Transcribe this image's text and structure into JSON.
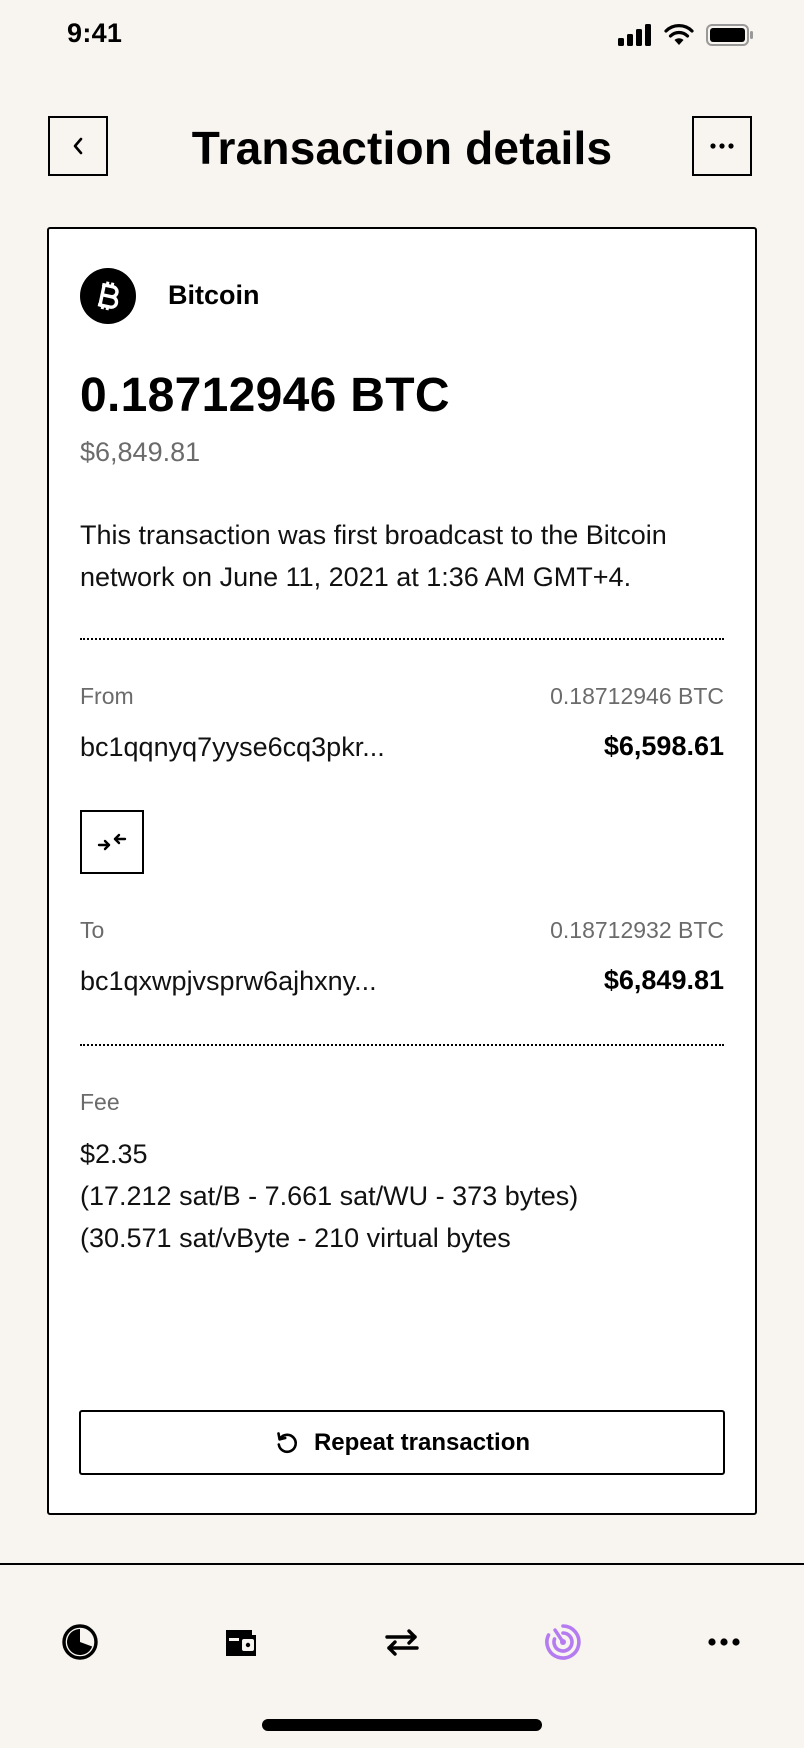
{
  "status_bar": {
    "time": "9:41"
  },
  "header": {
    "title": "Transaction details"
  },
  "coin": {
    "name": "Bitcoin",
    "icon": "bitcoin-icon"
  },
  "amount": {
    "crypto": "0.18712946 BTC",
    "fiat": "$6,849.81"
  },
  "description": "This transaction was first broadcast to the Bitcoin network on June 11, 2021 at 1:36 AM GMT+4.",
  "from": {
    "label": "From",
    "btc": "0.18712946 BTC",
    "address": "bc1qqnyq7yyse6cq3pkr...",
    "usd": "$6,598.61"
  },
  "to": {
    "label": "To",
    "btc": "0.18712932 BTC",
    "address": "bc1qxwpjvsprw6ajhxny...",
    "usd": "$6,849.81"
  },
  "fee": {
    "label": "Fee",
    "amount": "$2.35",
    "detail_1": "(17.212 sat/B - 7.661 sat/WU - 373 bytes)",
    "detail_2": "(30.571 sat/vByte - 210 virtual bytes"
  },
  "actions": {
    "repeat_label": "Repeat transaction"
  },
  "nav": {
    "items": [
      "portfolio-icon",
      "wallet-icon",
      "exchange-icon",
      "activity-icon",
      "more-icon"
    ],
    "active_index": 3,
    "active_color": "#b57bf0"
  }
}
